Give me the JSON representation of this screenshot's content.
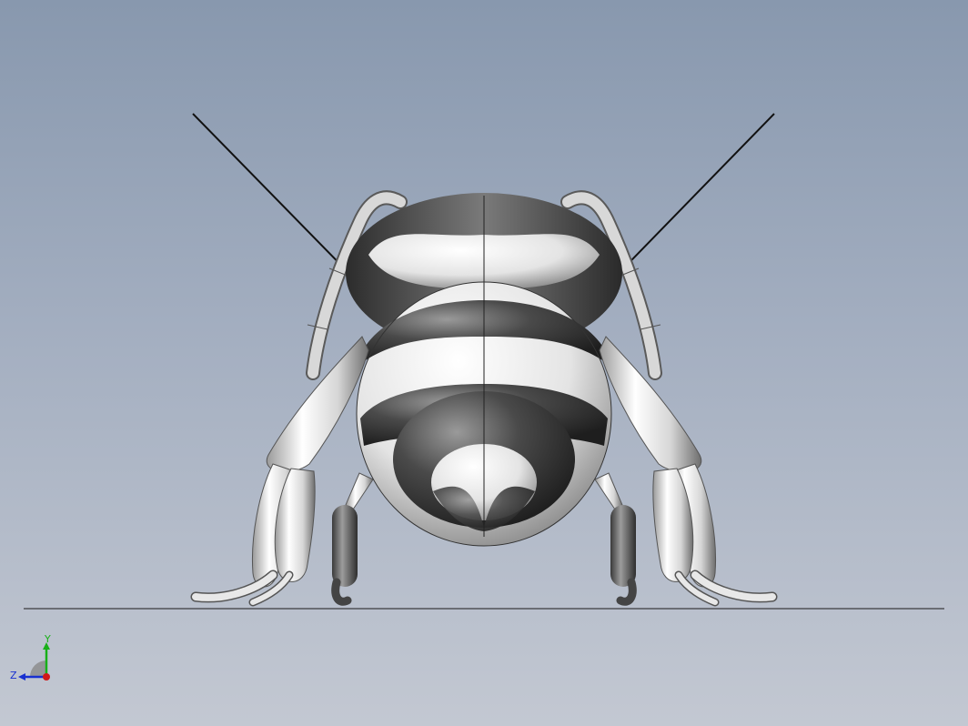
{
  "viewport": {
    "background_top": "#8898ae",
    "background_bottom": "#c3c8d2"
  },
  "model": {
    "name": "bee-model",
    "body_colors": {
      "dark": "#3c3c3c",
      "mid": "#8a8a8a",
      "light": "#f0f0f0"
    }
  },
  "triad": {
    "x_label": "",
    "y_label": "Y",
    "z_label": "Z",
    "colors": {
      "x": "#d01818",
      "y": "#18b018",
      "z": "#1830d0"
    }
  }
}
